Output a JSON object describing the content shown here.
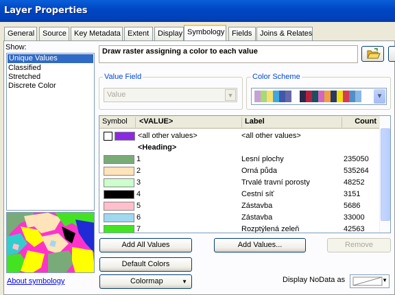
{
  "window": {
    "title": "Layer Properties"
  },
  "tabs": [
    "General",
    "Source",
    "Key Metadata",
    "Extent",
    "Display",
    "Symbology",
    "Fields",
    "Joins & Relates"
  ],
  "show": {
    "label": "Show:",
    "items": [
      "Unique Values",
      "Classified",
      "Stretched",
      "Discrete Color"
    ],
    "selected": "Unique Values"
  },
  "about_link": "About symbology",
  "description": "Draw raster assigning a color to each value",
  "value_field": {
    "title": "Value Field",
    "value": "Value"
  },
  "color_scheme": {
    "title": "Color Scheme",
    "colors": [
      "#c8a0d8",
      "#a8d878",
      "#f8e070",
      "#40a8e0",
      "#4058a8",
      "#6868a8",
      "#2a2a48",
      "#b82040",
      "#1a5060",
      "#d068c0",
      "#f0a040",
      "#2a3a60",
      "#f0e010",
      "#d83a50",
      "#5090c8",
      "#88b8e8"
    ]
  },
  "table": {
    "headers": [
      "Symbol",
      "<VALUE>",
      "Label",
      "Count"
    ],
    "other": {
      "value": "<all other values>",
      "label": "<all other values>",
      "color": "#8a2be2"
    },
    "heading": "<Heading>",
    "rows": [
      {
        "value": "1",
        "label": "Lesní plochy",
        "count": "235050",
        "color": "#79ab78"
      },
      {
        "value": "2",
        "label": "Orná půda",
        "count": "535264",
        "color": "#ffe3b9"
      },
      {
        "value": "3",
        "label": "Trvalé travní porosty",
        "count": "48252",
        "color": "#ccffcc"
      },
      {
        "value": "4",
        "label": "Cestní síť",
        "count": "3151",
        "color": "#000000"
      },
      {
        "value": "5",
        "label": "Zástavba",
        "count": "5686",
        "color": "#ffc0cb"
      },
      {
        "value": "6",
        "label": "Zástavba",
        "count": "33000",
        "color": "#a0d8ef"
      },
      {
        "value": "7",
        "label": "Rozptýlená zeleň",
        "count": "42563",
        "color": "#44e322"
      }
    ]
  },
  "buttons": {
    "add_all": "Add All Values",
    "add_values": "Add Values...",
    "remove": "Remove",
    "default_colors": "Default Colors",
    "colormap": "Colormap"
  },
  "nodata_label": "Display NoData as"
}
